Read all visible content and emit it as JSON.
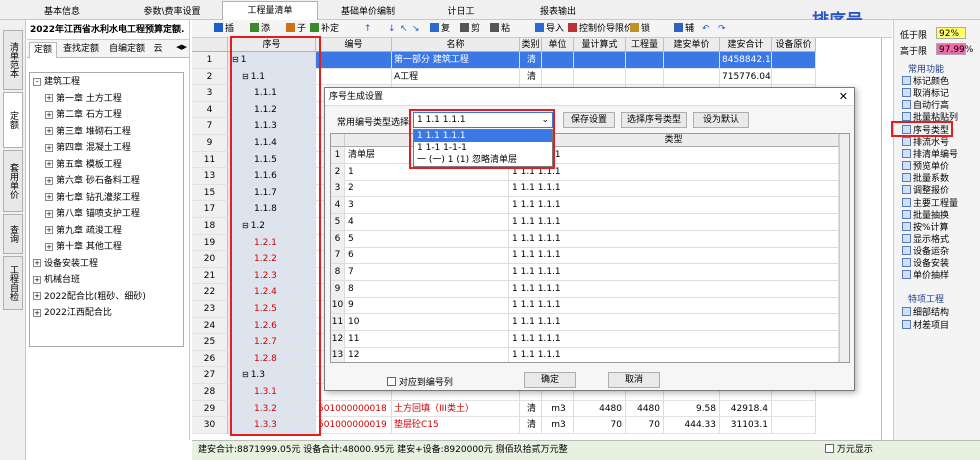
{
  "top_tabs": [
    "基本信息",
    "参数\\费率设置",
    "工程量清单",
    "基础单价编制",
    "计日工",
    "报表输出"
  ],
  "active_top_tab": 2,
  "annotation_title": "排序号",
  "side_vtabs": [
    "清单范本",
    "定额",
    "套用单价",
    "查询",
    "工程自检"
  ],
  "left_panel": {
    "title": "2022年江西省水利水电工程预算定额.",
    "subtabs": [
      "定额",
      "查找定额",
      "自编定额",
      "云"
    ],
    "tree": [
      {
        "label": "建筑工程",
        "level": 0,
        "exp": "-"
      },
      {
        "label": "第一章 土方工程",
        "level": 1,
        "exp": "+"
      },
      {
        "label": "第二章 石方工程",
        "level": 1,
        "exp": "+"
      },
      {
        "label": "第三章 堆砌石工程",
        "level": 1,
        "exp": "+"
      },
      {
        "label": "第四章 混凝土工程",
        "level": 1,
        "exp": "+"
      },
      {
        "label": "第五章 模板工程",
        "level": 1,
        "exp": "+"
      },
      {
        "label": "第六章 砂石备料工程",
        "level": 1,
        "exp": "+"
      },
      {
        "label": "第七章 钻孔灌浆工程",
        "level": 1,
        "exp": "+"
      },
      {
        "label": "第八章 锚喷支护工程",
        "level": 1,
        "exp": "+"
      },
      {
        "label": "第九章 疏浚工程",
        "level": 1,
        "exp": "+"
      },
      {
        "label": "第十章 其他工程",
        "level": 1,
        "exp": "+"
      },
      {
        "label": "设备安装工程",
        "level": 0,
        "exp": "+"
      },
      {
        "label": "机械台班",
        "level": 0,
        "exp": "+"
      },
      {
        "label": "2022配合比(粗砂、细砂)",
        "level": 0,
        "exp": "+"
      },
      {
        "label": "2022江西配合比",
        "level": 0,
        "exp": "+"
      }
    ]
  },
  "toolbar": [
    "插",
    "添",
    "子",
    "补定",
    "导入",
    "控制价导限价",
    "锁",
    "辅",
    "复",
    "剪",
    "粘"
  ],
  "grid": {
    "headers": [
      "序号",
      "编号",
      "名称",
      "类别",
      "单位",
      "量计算式",
      "工程量",
      "建安单价",
      "建安合计",
      "设备原价",
      "设备"
    ],
    "rows": [
      {
        "n": "1",
        "seq": "1",
        "code": "",
        "name": "第一部分 建筑工程",
        "cat": "清",
        "unit": "",
        "expr": "",
        "qty": "",
        "price": "",
        "total": "8458842.1",
        "sel": true
      },
      {
        "n": "2",
        "seq": "1.1",
        "code": "",
        "name": "A工程",
        "cat": "清",
        "unit": "",
        "expr": "",
        "qty": "",
        "price": "",
        "total": "715776.04"
      },
      {
        "n": "3",
        "seq": "1.1.1",
        "code": "",
        "name": "",
        "cat": "",
        "unit": "",
        "expr": "",
        "qty": "",
        "price": "",
        "total": ""
      },
      {
        "n": "4",
        "seq": "1.1.2",
        "code": "",
        "name": "",
        "cat": "",
        "unit": "",
        "expr": "",
        "qty": "",
        "price": "",
        "total": ""
      },
      {
        "n": "7",
        "seq": "1.1.3",
        "code": "",
        "name": "",
        "cat": "",
        "unit": "",
        "expr": "",
        "qty": "",
        "price": "",
        "total": ""
      },
      {
        "n": "9",
        "seq": "1.1.4",
        "code": "",
        "name": "",
        "cat": "",
        "unit": "",
        "expr": "",
        "qty": "",
        "price": "",
        "total": ""
      },
      {
        "n": "11",
        "seq": "1.1.5",
        "code": "",
        "name": "",
        "cat": "",
        "unit": "",
        "expr": "",
        "qty": "",
        "price": "",
        "total": ""
      },
      {
        "n": "13",
        "seq": "1.1.6",
        "code": "",
        "name": "",
        "cat": "",
        "unit": "",
        "expr": "",
        "qty": "",
        "price": "",
        "total": ""
      },
      {
        "n": "15",
        "seq": "1.1.7",
        "code": "",
        "name": "",
        "cat": "",
        "unit": "",
        "expr": "",
        "qty": "",
        "price": "",
        "total": ""
      },
      {
        "n": "17",
        "seq": "1.1.8",
        "code": "",
        "name": "",
        "cat": "",
        "unit": "",
        "expr": "",
        "qty": "",
        "price": "",
        "total": ""
      },
      {
        "n": "18",
        "seq": "1.2",
        "code": "",
        "name": "",
        "cat": "",
        "unit": "",
        "expr": "",
        "qty": "",
        "price": "",
        "total": ""
      },
      {
        "n": "19",
        "seq": "1.2.1",
        "code": "",
        "name": "",
        "cat": "",
        "unit": "",
        "expr": "",
        "qty": "",
        "price": "",
        "total": "",
        "red": true
      },
      {
        "n": "20",
        "seq": "1.2.2",
        "code": "",
        "name": "",
        "cat": "",
        "unit": "",
        "expr": "",
        "qty": "",
        "price": "",
        "total": "",
        "red": true
      },
      {
        "n": "21",
        "seq": "1.2.3",
        "code": "",
        "name": "",
        "cat": "",
        "unit": "",
        "expr": "",
        "qty": "",
        "price": "",
        "total": "",
        "red": true
      },
      {
        "n": "22",
        "seq": "1.2.4",
        "code": "",
        "name": "",
        "cat": "",
        "unit": "",
        "expr": "",
        "qty": "",
        "price": "",
        "total": "",
        "red": true
      },
      {
        "n": "23",
        "seq": "1.2.5",
        "code": "",
        "name": "",
        "cat": "",
        "unit": "",
        "expr": "",
        "qty": "",
        "price": "",
        "total": "",
        "red": true
      },
      {
        "n": "24",
        "seq": "1.2.6",
        "code": "",
        "name": "",
        "cat": "",
        "unit": "",
        "expr": "",
        "qty": "",
        "price": "",
        "total": "",
        "red": true
      },
      {
        "n": "25",
        "seq": "1.2.7",
        "code": "",
        "name": "",
        "cat": "",
        "unit": "",
        "expr": "",
        "qty": "",
        "price": "",
        "total": "",
        "red": true
      },
      {
        "n": "26",
        "seq": "1.2.8",
        "code": "",
        "name": "",
        "cat": "",
        "unit": "",
        "expr": "",
        "qty": "",
        "price": "",
        "total": "",
        "red": true
      },
      {
        "n": "27",
        "seq": "1.3",
        "code": "",
        "name": "",
        "cat": "",
        "unit": "",
        "expr": "",
        "qty": "",
        "price": "",
        "total": ""
      },
      {
        "n": "28",
        "seq": "1.3.1",
        "code": "",
        "name": "",
        "cat": "",
        "unit": "",
        "expr": "",
        "qty": "",
        "price": "",
        "total": "",
        "red": true
      },
      {
        "n": "29",
        "seq": "1.3.2",
        "code": "501000000018",
        "name": "土方回填（III类土）",
        "cat": "清",
        "unit": "m3",
        "expr": "4480",
        "qty": "4480",
        "price": "9.58",
        "total": "42918.4",
        "red": true
      },
      {
        "n": "30",
        "seq": "1.3.3",
        "code": "501000000019",
        "name": "垫层砼C15",
        "cat": "清",
        "unit": "m3",
        "expr": "70",
        "qty": "70",
        "price": "444.33",
        "total": "31103.1",
        "red": true
      }
    ]
  },
  "status": "建安合计:8871999.05元 设备合计:48000.95元 建安+设备:8920000元 捌佰玖拾贰万元整",
  "status_checkbox": "万元显示",
  "right_panel": {
    "low_label": "低于限",
    "low_val": "92%",
    "high_label": "高于限",
    "high_val": "97.99%",
    "group1": "常用功能",
    "items1": [
      "标记颜色",
      "取消标记",
      "自动行高",
      "批量粘贴列",
      "序号类型",
      "排流水号",
      "排清单编号",
      "预览单价",
      "批量系数",
      "调整报价",
      "主要工程量",
      "批量抽换",
      "按%计算",
      "显示格式",
      "设备运杂",
      "设备安装",
      "单价抽样"
    ],
    "group2": "特项工程",
    "items2": [
      "细部结构",
      "材差项目"
    ]
  },
  "dialog": {
    "title": "序号生成设置",
    "combo_label": "常用编号类型选择",
    "combo_value": "1  1.1  1.1.1",
    "btn_save": "保存设置",
    "btn_select": "选择序号类型",
    "btn_default": "设为默认",
    "dropdown": [
      "1  1.1  1.1.1",
      "1  1-1  1-1-1",
      "一  (一)  1  (1)   忽略清单层"
    ],
    "col_type": "类型",
    "rows": [
      {
        "n": "1",
        "a": "清单层",
        "b": "1  1.1  1.1.1"
      },
      {
        "n": "2",
        "a": "1",
        "b": "1  1.1  1.1.1"
      },
      {
        "n": "3",
        "a": "2",
        "b": "1  1.1  1.1.1"
      },
      {
        "n": "4",
        "a": "3",
        "b": "1  1.1  1.1.1"
      },
      {
        "n": "5",
        "a": "4",
        "b": "1  1.1  1.1.1"
      },
      {
        "n": "6",
        "a": "5",
        "b": "1  1.1  1.1.1"
      },
      {
        "n": "7",
        "a": "6",
        "b": "1  1.1  1.1.1"
      },
      {
        "n": "8",
        "a": "7",
        "b": "1  1.1  1.1.1"
      },
      {
        "n": "9",
        "a": "8",
        "b": "1  1.1  1.1.1"
      },
      {
        "n": "10",
        "a": "9",
        "b": "1  1.1  1.1.1"
      },
      {
        "n": "11",
        "a": "10",
        "b": "1  1.1  1.1.1"
      },
      {
        "n": "12",
        "a": "11",
        "b": "1  1.1  1.1.1"
      },
      {
        "n": "13",
        "a": "12",
        "b": "1  1.1  1.1.1"
      }
    ],
    "checkbox_label": "对应到编号列",
    "ok": "确定",
    "cancel": "取消"
  }
}
